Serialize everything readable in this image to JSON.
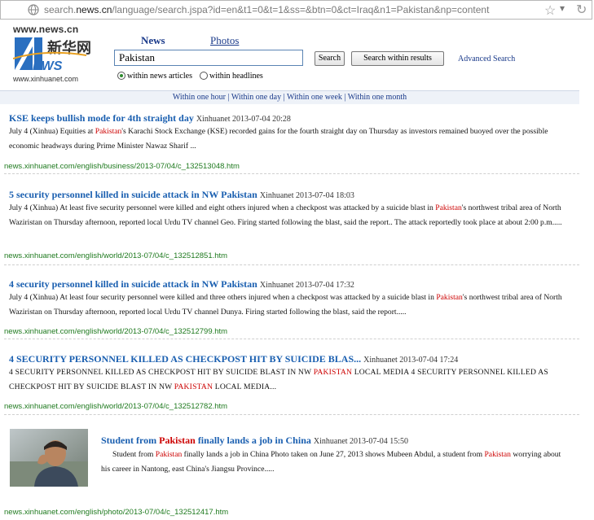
{
  "browser": {
    "url_prefix": "search.",
    "url_host": "news.cn",
    "url_rest": "/language/search.jspa?id=en&t1=0&t=1&ss=&btn=0&ct=Iraq&n1=Pakistan&np=content"
  },
  "logo": {
    "top_text": "www.news.cn",
    "bottom_text": "www.xinhuanet.com"
  },
  "nav": {
    "news_label": "News",
    "photos_label": "Photos"
  },
  "search": {
    "query": "Pakistan",
    "search_label": "Search",
    "within_label": "Search within results",
    "advanced_label": "Advanced Search",
    "radio_news": "within news articles",
    "radio_headlines": "within headlines",
    "selected": "within news articles"
  },
  "timefilter": {
    "hour": "Within one hour",
    "day": "Within one day",
    "week": "Within one week",
    "month": "Within one month",
    "sep": "|"
  },
  "results": [
    {
      "title": "KSE keeps bullish mode for 4th straight day",
      "source": "Xinhuanet",
      "date": "2013-07-04 20:28",
      "snippet_a": "July 4 (Xinhua) Equities at ",
      "snippet_hl": "Pakistan",
      "snippet_b": "'s Karachi Stock Exchange (KSE) recorded gains for the fourth straight day on Thursday as investors remained buoyed over the possible economic headways during Prime Minister Nawaz Sharif ...",
      "url": "news.xinhuanet.com/english/business/2013-07/04/c_132513048.htm"
    },
    {
      "title": "5 security personnel killed in suicide attack in NW Pakistan",
      "source": "Xinhuanet",
      "date": "2013-07-04 18:03",
      "snippet_a": "July 4 (Xinhua) At least five security personnel were killed and eight others injured when a checkpost was attacked by a suicide blast in ",
      "snippet_hl": "Pakistan",
      "snippet_b": "'s northwest tribal area of North Waziristan on Thursday afternoon, reported local Urdu TV channel Geo. Firing started following the blast, said the report.. The attack reportedly took place at about 2:00 p.m.....",
      "url": "news.xinhuanet.com/english/world/2013-07/04/c_132512851.htm"
    },
    {
      "title": "4 security personnel killed in suicide attack in NW Pakistan",
      "source": "Xinhuanet",
      "date": "2013-07-04 17:32",
      "snippet_a": "July 4 (Xinhua) At least four security personnel were killed and three others injured when a checkpost was attacked by a suicide blast in ",
      "snippet_hl": "Pakistan",
      "snippet_b": "'s northwest tribal area of North Waziristan on Thursday afternoon, reported local Urdu TV channel Dunya. Firing started following the blast, said the report.....",
      "url": "news.xinhuanet.com/english/world/2013-07/04/c_132512799.htm"
    },
    {
      "title": "4 SECURITY PERSONNEL KILLED AS CHECKPOST HIT BY SUICIDE BLAS...",
      "source": "Xinhuanet",
      "date": "2013-07-04 17:24",
      "snippet_a": "4 SECURITY PERSONNEL KILLED AS CHECKPOST HIT BY SUICIDE BLAST IN NW ",
      "snippet_hl": "PAKISTAN",
      "snippet_b": " LOCAL MEDIA 4 SECURITY PERSONNEL KILLED AS CHECKPOST HIT BY SUICIDE BLAST IN NW ",
      "snippet_hl2": "PAKISTAN",
      "snippet_c": " LOCAL MEDIA...",
      "url": "news.xinhuanet.com/english/world/2013-07/04/c_132512782.htm"
    },
    {
      "title_a": "Student from ",
      "title_hl": "Pakistan",
      "title_b": " finally lands a job in China",
      "source": "Xinhuanet",
      "date": "2013-07-04 15:50",
      "snippet_a": "Student from ",
      "snippet_hl": "Pakistan",
      "snippet_b": " finally lands a job in China Photo taken on June 27, 2013 shows Mubeen Abdul, a student from ",
      "snippet_hl2": "Pakistan",
      "snippet_c": " worrying about his career in Nantong, east China's Jiangsu Province.....",
      "url": "news.xinhuanet.com/english/photo/2013-07/04/c_132512417.htm"
    }
  ]
}
